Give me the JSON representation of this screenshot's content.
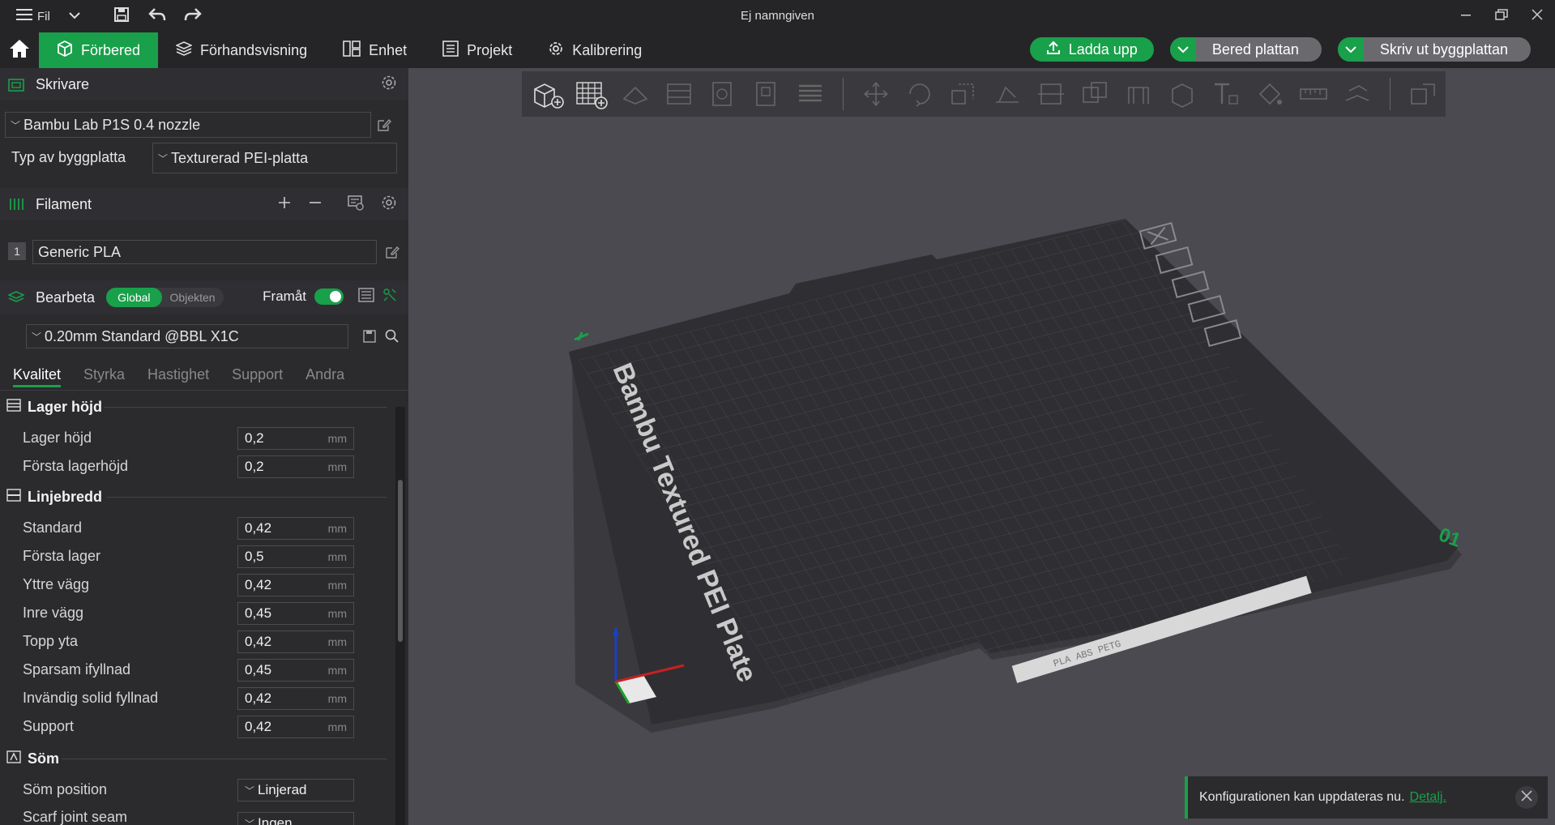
{
  "window": {
    "title": "Ej namngiven",
    "menu_label": "Fil"
  },
  "tabs": [
    {
      "label": "Förbered",
      "active": true
    },
    {
      "label": "Förhandsvisning"
    },
    {
      "label": "Enhet"
    },
    {
      "label": "Projekt"
    },
    {
      "label": "Kalibrering"
    }
  ],
  "actions": {
    "upload": "Ladda upp",
    "prepare_plate": "Bered plattan",
    "print_plate": "Skriv ut byggplattan"
  },
  "printer": {
    "section_title": "Skrivare",
    "model": "Bambu Lab P1S 0.4 nozzle",
    "plate_type_label": "Typ av byggplatta",
    "plate_type_value": "Texturerad PEI-platta"
  },
  "filament": {
    "section_title": "Filament",
    "items": [
      {
        "index": "1",
        "name": "Generic PLA"
      }
    ]
  },
  "process": {
    "section_title": "Bearbeta",
    "scope_global": "Global",
    "scope_objects": "Objekten",
    "advanced_label": "Framåt",
    "advanced_on": true,
    "preset": "0.20mm Standard @BBL X1C",
    "subtabs": [
      "Kvalitet",
      "Styrka",
      "Hastighet",
      "Support",
      "Andra"
    ],
    "active_subtab": "Kvalitet"
  },
  "groups": {
    "layer_height": {
      "title": "Lager höjd",
      "params": [
        {
          "label": "Lager höjd",
          "value": "0,2",
          "unit": "mm"
        },
        {
          "label": "Första lagerhöjd",
          "value": "0,2",
          "unit": "mm"
        }
      ]
    },
    "line_width": {
      "title": "Linjebredd",
      "params": [
        {
          "label": "Standard",
          "value": "0,42",
          "unit": "mm"
        },
        {
          "label": "Första lager",
          "value": "0,5",
          "unit": "mm"
        },
        {
          "label": "Yttre vägg",
          "value": "0,42",
          "unit": "mm"
        },
        {
          "label": "Inre vägg",
          "value": "0,45",
          "unit": "mm"
        },
        {
          "label": "Topp yta",
          "value": "0,42",
          "unit": "mm"
        },
        {
          "label": "Sparsam ifyllnad",
          "value": "0,45",
          "unit": "mm"
        },
        {
          "label": "Invändig solid fyllnad",
          "value": "0,42",
          "unit": "mm"
        },
        {
          "label": "Support",
          "value": "0,42",
          "unit": "mm"
        }
      ]
    },
    "seam": {
      "title": "Söm",
      "params": [
        {
          "label": "Söm position",
          "value": "Linjerad"
        },
        {
          "label": "Scarf joint seam",
          "value": "Ingen"
        }
      ]
    }
  },
  "plate": {
    "label": "Bambu Textured PEI Plate",
    "plate_number": "01",
    "bottom_text": "PLA ABS PETG"
  },
  "toast": {
    "message": "Konfigurationen kan uppdateras nu.",
    "link": "Detalj."
  },
  "colors": {
    "accent": "#19a04a",
    "panel": "#2b2b2e",
    "viewport": "#4a4a50",
    "bar": "#252528"
  }
}
